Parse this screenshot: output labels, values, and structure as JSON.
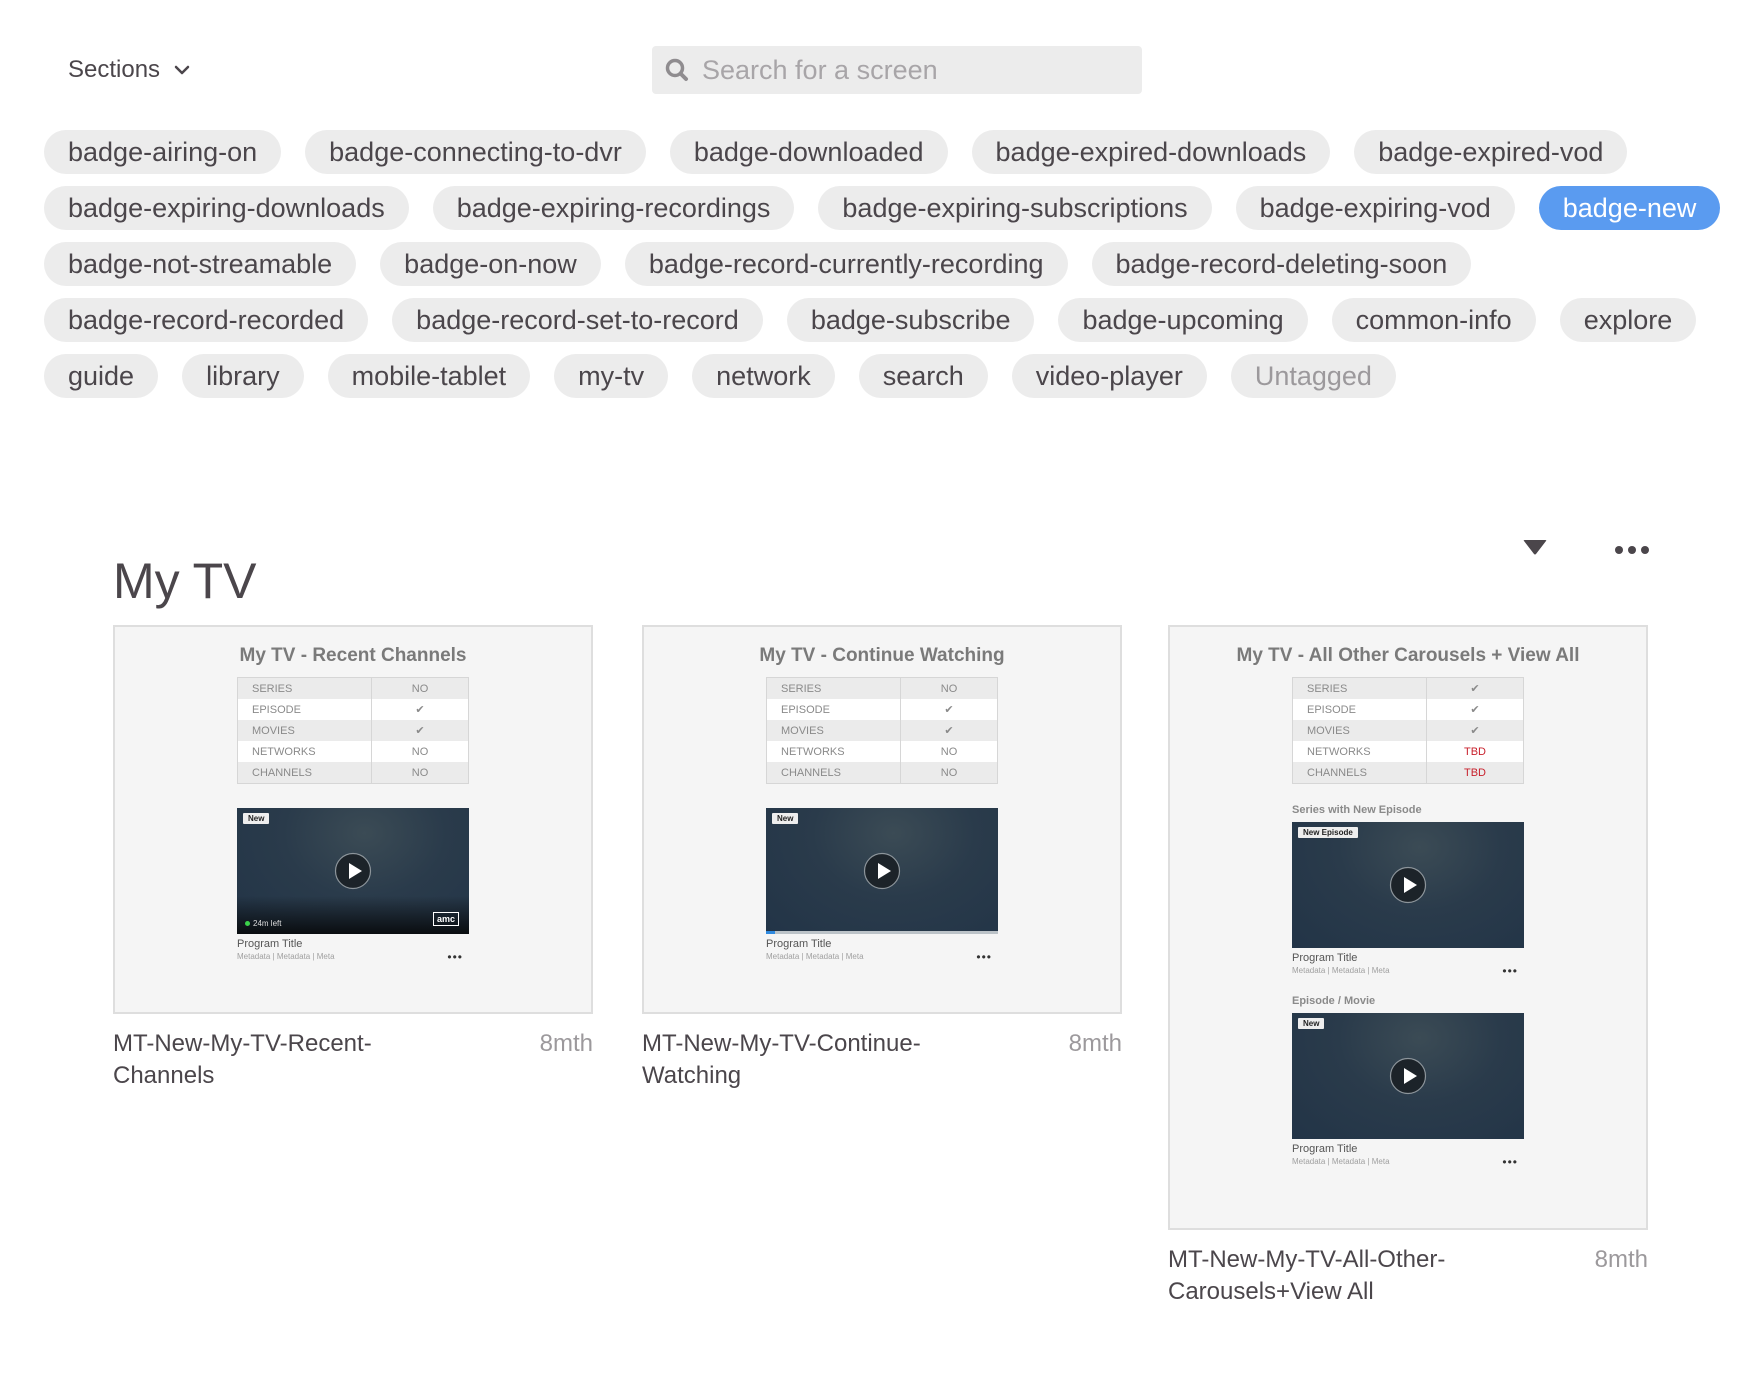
{
  "toolbar": {
    "sections_label": "Sections",
    "search_placeholder": "Search for a screen",
    "search_value": ""
  },
  "tags": [
    {
      "label": "badge-airing-on",
      "state": "normal"
    },
    {
      "label": "badge-connecting-to-dvr",
      "state": "normal"
    },
    {
      "label": "badge-downloaded",
      "state": "normal"
    },
    {
      "label": "badge-expired-downloads",
      "state": "normal"
    },
    {
      "label": "badge-expired-vod",
      "state": "normal"
    },
    {
      "label": "badge-expiring-downloads",
      "state": "normal"
    },
    {
      "label": "badge-expiring-recordings",
      "state": "normal"
    },
    {
      "label": "badge-expiring-subscriptions",
      "state": "normal"
    },
    {
      "label": "badge-expiring-vod",
      "state": "normal"
    },
    {
      "label": "badge-new",
      "state": "selected"
    },
    {
      "label": "badge-not-streamable",
      "state": "normal"
    },
    {
      "label": "badge-on-now",
      "state": "normal"
    },
    {
      "label": "badge-record-currently-recording",
      "state": "normal"
    },
    {
      "label": "badge-record-deleting-soon",
      "state": "normal"
    },
    {
      "label": "badge-record-recorded",
      "state": "normal"
    },
    {
      "label": "badge-record-set-to-record",
      "state": "normal"
    },
    {
      "label": "badge-subscribe",
      "state": "normal"
    },
    {
      "label": "badge-upcoming",
      "state": "normal"
    },
    {
      "label": "common-info",
      "state": "normal"
    },
    {
      "label": "explore",
      "state": "normal"
    },
    {
      "label": "guide",
      "state": "normal"
    },
    {
      "label": "library",
      "state": "normal"
    },
    {
      "label": "mobile-tablet",
      "state": "normal"
    },
    {
      "label": "my-tv",
      "state": "normal"
    },
    {
      "label": "network",
      "state": "normal"
    },
    {
      "label": "search",
      "state": "normal"
    },
    {
      "label": "video-player",
      "state": "normal"
    },
    {
      "label": "Untagged",
      "state": "muted"
    }
  ],
  "colors": {
    "selected_tag": "#5a9bf0",
    "tbd_red": "#c8202c",
    "progress_blue": "#2f8ae0",
    "live_dot": "#3bd24a"
  },
  "section": {
    "title": "My TV",
    "cards": [
      {
        "thumb_title": "My TV - Recent Channels",
        "table": [
          {
            "label": "SERIES",
            "value": "NO",
            "red": false
          },
          {
            "label": "EPISODE",
            "value": "✔",
            "red": false
          },
          {
            "label": "MOVIES",
            "value": "✔",
            "red": false
          },
          {
            "label": "NETWORKS",
            "value": "NO",
            "red": false
          },
          {
            "label": "CHANNELS",
            "value": "NO",
            "red": false
          }
        ],
        "tiles": [
          {
            "label": "",
            "badge": "New",
            "time_left": "24m left",
            "network_logo": "amc",
            "progress": null,
            "program_title": "Program Title",
            "metadata": "Metadata | Metadata | Meta"
          }
        ],
        "name": "MT-New-My-TV-Recent-Channels",
        "age": "8mth"
      },
      {
        "thumb_title": "My TV - Continue Watching",
        "table": [
          {
            "label": "SERIES",
            "value": "NO",
            "red": false
          },
          {
            "label": "EPISODE",
            "value": "✔",
            "red": false
          },
          {
            "label": "MOVIES",
            "value": "✔",
            "red": false
          },
          {
            "label": "NETWORKS",
            "value": "NO",
            "red": false
          },
          {
            "label": "CHANNELS",
            "value": "NO",
            "red": false
          }
        ],
        "tiles": [
          {
            "label": "",
            "badge": "New",
            "time_left": "",
            "network_logo": "",
            "progress": 0.04,
            "program_title": "Program Title",
            "metadata": "Metadata | Metadata | Meta"
          }
        ],
        "name": "MT-New-My-TV-Continue-Watching",
        "age": "8mth"
      },
      {
        "thumb_title": "My TV - All Other Carousels + View All",
        "table": [
          {
            "label": "SERIES",
            "value": "✔",
            "red": false
          },
          {
            "label": "EPISODE",
            "value": "✔",
            "red": false
          },
          {
            "label": "MOVIES",
            "value": "✔",
            "red": false
          },
          {
            "label": "NETWORKS",
            "value": "TBD",
            "red": true
          },
          {
            "label": "CHANNELS",
            "value": "TBD",
            "red": true
          }
        ],
        "tiles": [
          {
            "label": "Series with New Episode",
            "badge": "New Episode",
            "time_left": "",
            "network_logo": "",
            "progress": null,
            "program_title": "Program Title",
            "metadata": "Metadata | Metadata | Meta"
          },
          {
            "label": "Episode / Movie",
            "badge": "New",
            "time_left": "",
            "network_logo": "",
            "progress": null,
            "program_title": "Program Title",
            "metadata": "Metadata | Metadata | Meta"
          }
        ],
        "name": "MT-New-My-TV-All-Other-Carousels+View All",
        "age": "8mth"
      }
    ]
  }
}
